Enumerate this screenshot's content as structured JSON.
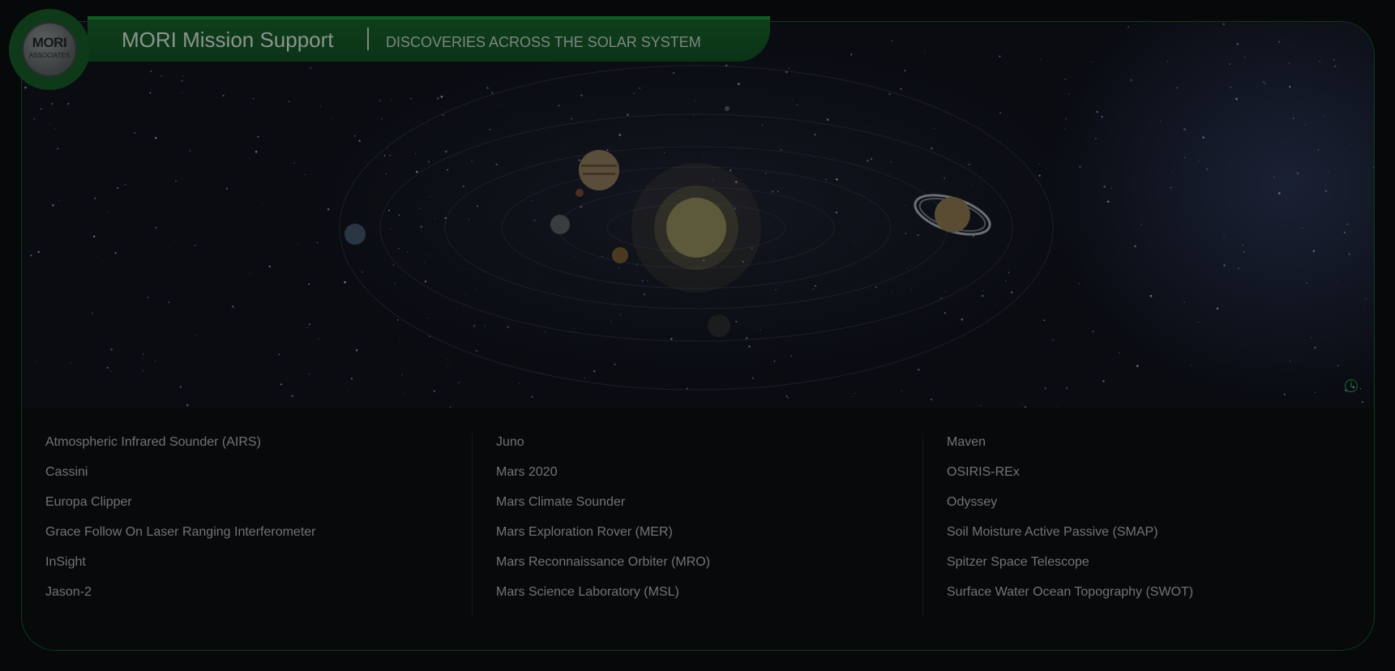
{
  "header": {
    "logo_top": "MORI",
    "logo_bottom": "ASSOCIATES",
    "title": "MORI Mission Support",
    "subtitle": "DISCOVERIES ACROSS THE SOLAR SYSTEM"
  },
  "info_button": {
    "icon": "info-icon",
    "glyph": "i"
  },
  "colors": {
    "banner": "#0f3f1c",
    "accent": "#145a26",
    "text": "#6f7477"
  },
  "missions": {
    "column1": [
      "Atmospheric Infrared Sounder (AIRS)",
      "Cassini",
      "Europa Clipper",
      "Grace Follow On Laser Ranging Interferometer",
      "InSight",
      "Jason-2"
    ],
    "column2": [
      "Juno",
      "Mars 2020",
      "Mars Climate Sounder",
      "Mars Exploration Rover (MER)",
      "Mars Reconnaissance Orbiter (MRO)",
      "Mars Science Laboratory (MSL)"
    ],
    "column3": [
      "Maven",
      "OSIRIS-REx",
      "Odyssey",
      "Soil Moisture Active Passive (SMAP)",
      "Spitzer Space Telescope",
      "Surface Water Ocean Topography (SWOT)"
    ]
  }
}
